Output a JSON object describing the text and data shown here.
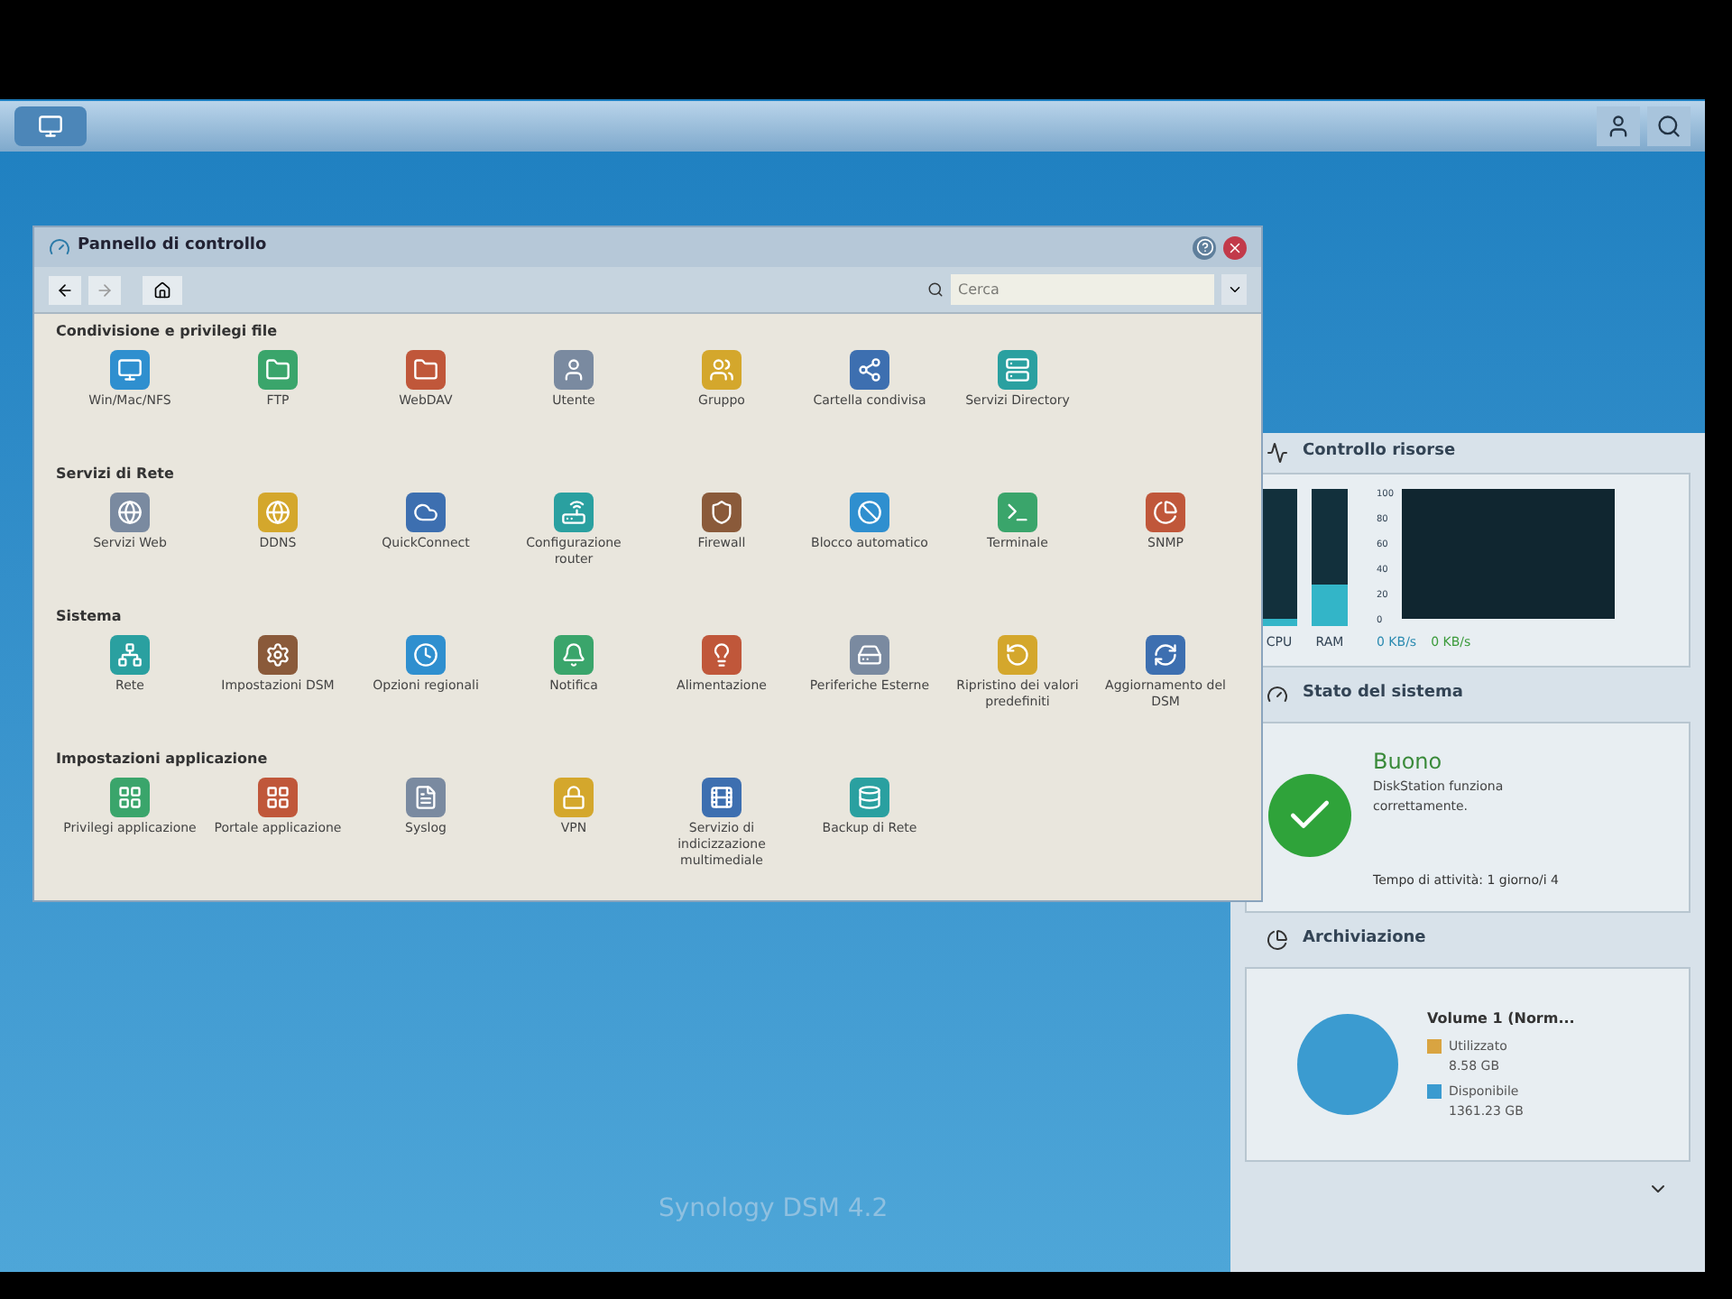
{
  "window": {
    "title": "Pannello di controllo",
    "search": {
      "placeholder": "Cerca"
    },
    "sections": [
      {
        "title": "Condivisione e privilegi file",
        "items": [
          "Win/Mac/NFS",
          "FTP",
          "WebDAV",
          "Utente",
          "Gruppo",
          "Cartella condivisa",
          "Servizi Directory"
        ]
      },
      {
        "title": "Servizi di Rete",
        "items": [
          "Servizi Web",
          "DDNS",
          "QuickConnect",
          "Configurazione router",
          "Firewall",
          "Blocco automatico",
          "Terminale",
          "SNMP"
        ]
      },
      {
        "title": "Sistema",
        "items": [
          "Rete",
          "Impostazioni DSM",
          "Opzioni regionali",
          "Notifica",
          "Alimentazione",
          "Periferiche Esterne",
          "Ripristino dei valori predefiniti",
          "Aggiornamento del DSM"
        ]
      },
      {
        "title": "Impostazioni applicazione",
        "items": [
          "Privilegi applicazione",
          "Portale applicazione",
          "Syslog",
          "VPN",
          "Servizio di indicizzazione multimediale",
          "Backup di Rete"
        ]
      }
    ]
  },
  "widgets": {
    "resources": {
      "title": "Controllo risorse",
      "meters": [
        {
          "label": "CPU",
          "level": 0.05
        },
        {
          "label": "RAM",
          "level": 0.3
        }
      ],
      "graph_axis": [
        "100",
        "80",
        "60",
        "40",
        "20",
        "0"
      ],
      "upload": "0 KB/s",
      "download": "0 KB/s"
    },
    "status": {
      "title": "Stato del sistema",
      "state": "Buono",
      "message": "DiskStation funziona correttamente.",
      "uptime": "Tempo di attività: 1 giorno/i 4"
    },
    "storage": {
      "title": "Archiviazione",
      "volume": "Volume 1 (Norm...",
      "legend": [
        {
          "label": "Utilizzato",
          "value": "8.58 GB",
          "color": "#d9a441"
        },
        {
          "label": "Disponibile",
          "value": "1361.23 GB",
          "color": "#3b9bd0"
        }
      ]
    }
  },
  "brand": "Synology DSM 4.2"
}
